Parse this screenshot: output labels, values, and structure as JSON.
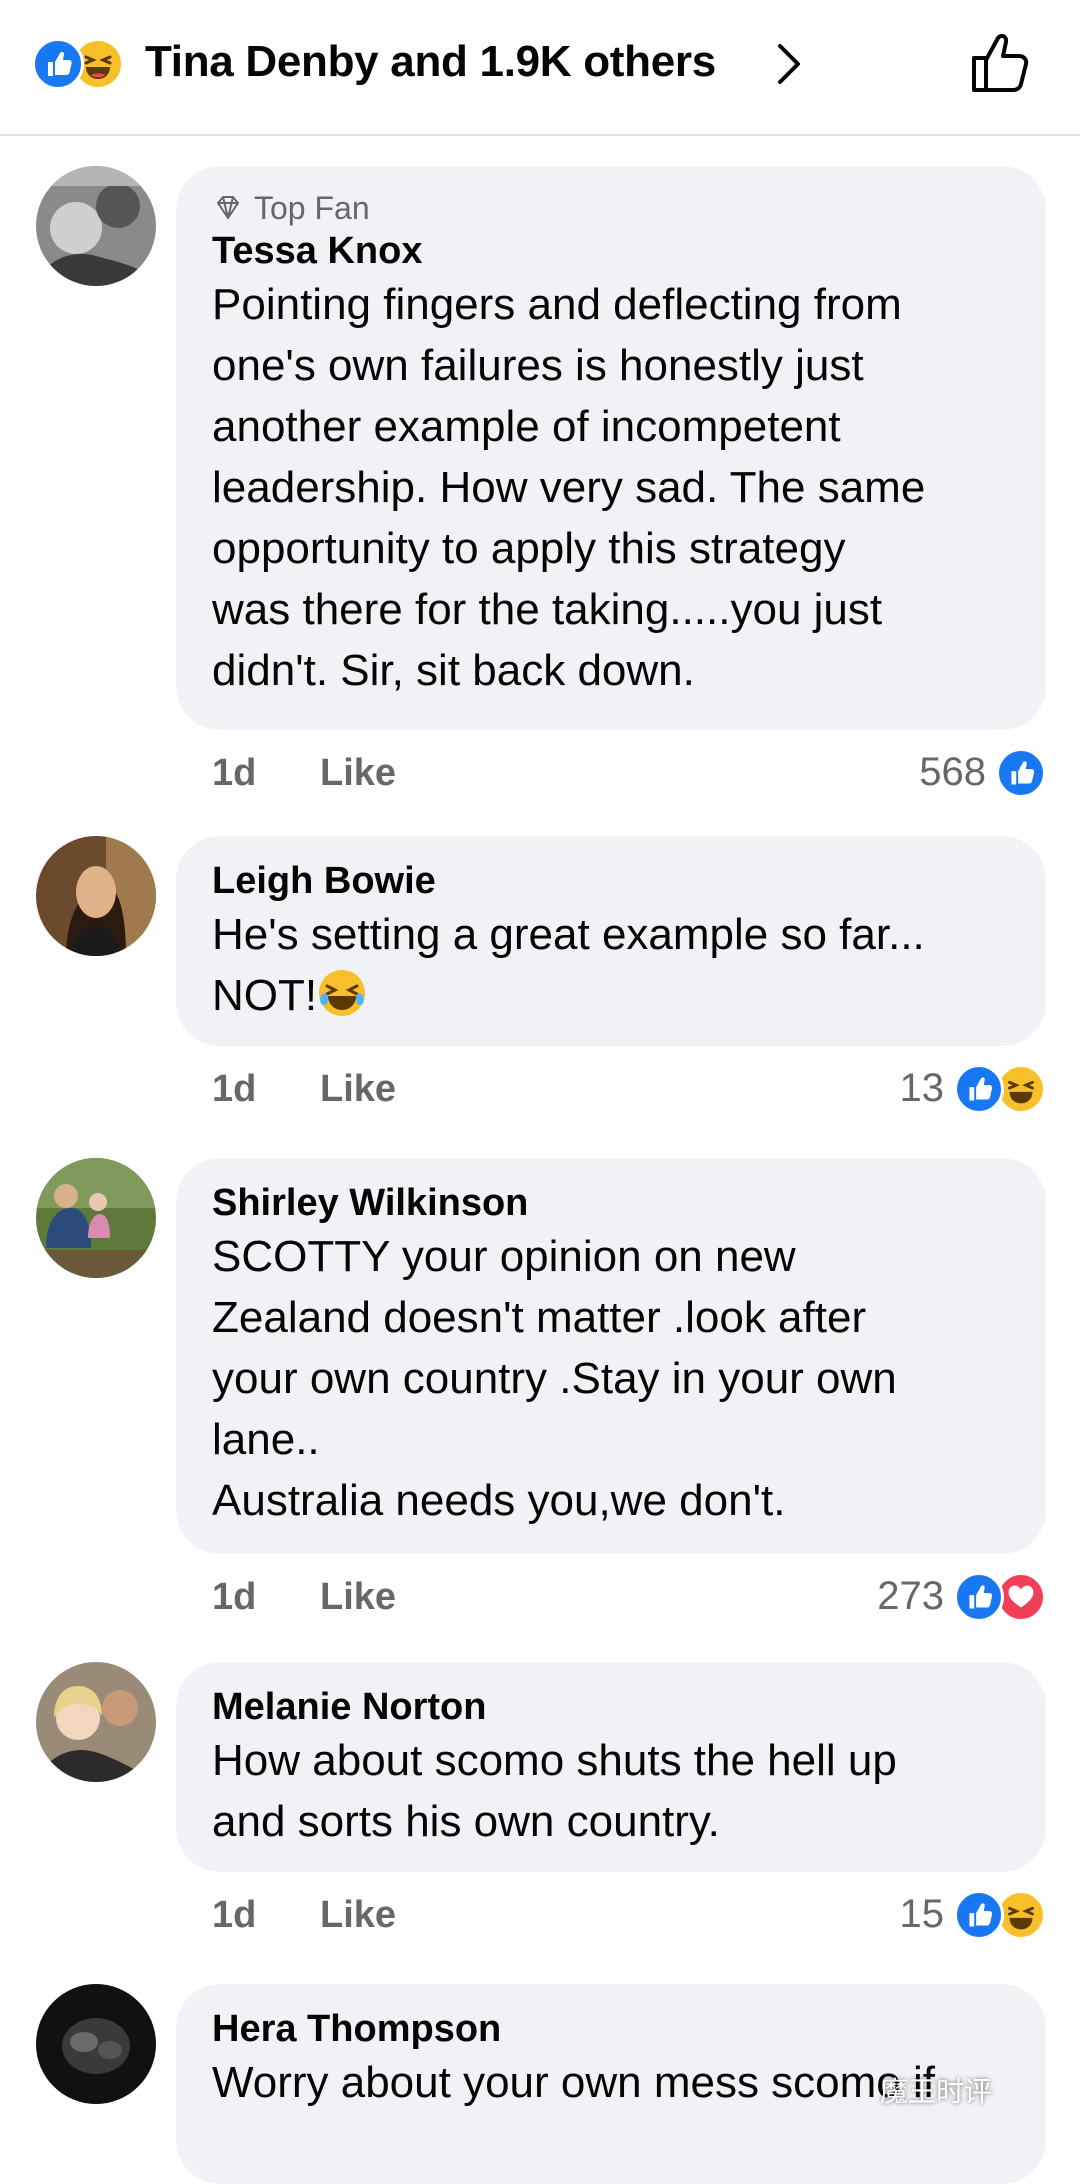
{
  "header": {
    "reactors_label": "Tina Denby and 1.9K others",
    "reaction_icons": [
      "like-icon",
      "haha-icon"
    ]
  },
  "comments": [
    {
      "badge": "Top Fan",
      "author": "Tessa Knox",
      "text": "Pointing fingers and deflecting from\none's own failures is honestly just\nanother example of incompetent\nleadership. How very sad. The same\nopportunity to apply this strategy\nwas there for the taking.....you just\ndidn't. Sir, sit back down.",
      "time": "1d",
      "like_label": "Like",
      "reaction_count": "568",
      "reactions": [
        "like"
      ]
    },
    {
      "author": "Leigh Bowie",
      "text": "He's setting a great example so far...\nNOT!",
      "trailing_emoji": "laughing-emoji",
      "time": "1d",
      "like_label": "Like",
      "reaction_count": "13",
      "reactions": [
        "like",
        "haha"
      ]
    },
    {
      "author": "Shirley Wilkinson",
      "text": "SCOTTY your opinion on new\nZealand doesn't matter .look after\nyour own country .Stay in your own\nlane..\nAustralia needs you,we don't.",
      "time": "1d",
      "like_label": "Like",
      "reaction_count": "273",
      "reactions": [
        "like",
        "love"
      ]
    },
    {
      "author": "Melanie Norton",
      "text": "How about scomo shuts the hell up\nand sorts his own country.",
      "time": "1d",
      "like_label": "Like",
      "reaction_count": "15",
      "reactions": [
        "like",
        "haha"
      ]
    },
    {
      "author": "Hera Thompson",
      "text": "Worry about your own mess scomo if"
    }
  ],
  "watermark": "魔王时评",
  "colors": {
    "like_blue": "#1877f2",
    "haha_yellow": "#f7c02b",
    "love_red": "#f33e58",
    "bubble_bg": "#f0f2f5",
    "meta_gray": "#65676b"
  }
}
